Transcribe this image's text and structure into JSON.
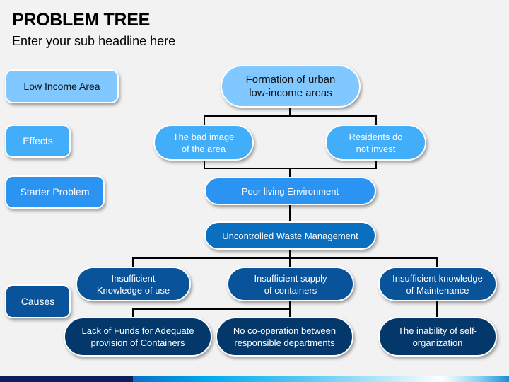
{
  "header": {
    "title": "PROBLEM TREE",
    "subtitle": "Enter your sub headline here"
  },
  "legend": [
    {
      "label": "Low Income Area",
      "color": "#80c8ff"
    },
    {
      "label": "Effects",
      "color": "#42adf8"
    },
    {
      "label": "Starter Problem",
      "color": "#2b93f2"
    },
    {
      "label": "Causes",
      "color": "#08539a"
    }
  ],
  "tree": {
    "root": {
      "label": "Formation of urban\nlow-income areas"
    },
    "effects": [
      {
        "label": "The bad image\nof the area"
      },
      {
        "label": "Residents do\nnot invest"
      }
    ],
    "starter_problem": {
      "label": "Poor living Environment"
    },
    "core_problem": {
      "label": "Uncontrolled Waste Management"
    },
    "causes": [
      {
        "label": "Insufficient\nKnowledge of use"
      },
      {
        "label": "Insufficient supply\nof containers"
      },
      {
        "label": "Insufficient knowledge\nof Maintenance"
      }
    ],
    "root_causes": [
      {
        "label": "Lack of Funds for Adequate\nprovision of Containers"
      },
      {
        "label": "No co-operation between\nresponsible departments"
      },
      {
        "label": "The inability of self-\norganization"
      }
    ]
  }
}
